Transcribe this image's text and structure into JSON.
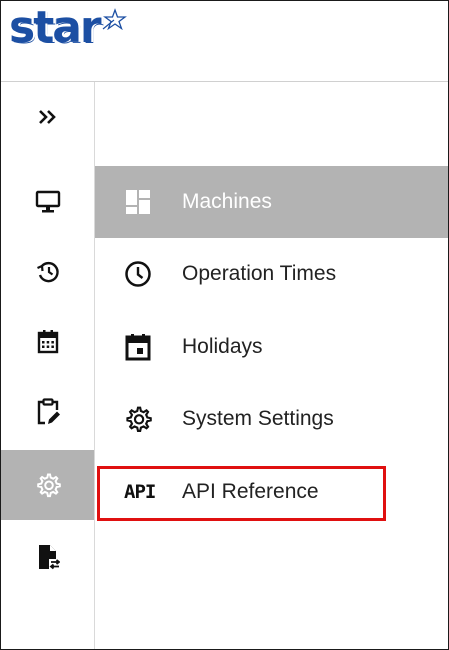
{
  "brand": {
    "logo_text": "star"
  },
  "rail": {
    "expand": {
      "icon": "double-chevron-right-icon",
      "glyph": "»"
    },
    "items": [
      {
        "key": "monitor",
        "icon": "monitor-icon"
      },
      {
        "key": "history",
        "icon": "history-icon"
      },
      {
        "key": "calendar",
        "icon": "calendar-icon"
      },
      {
        "key": "clipboard",
        "icon": "clipboard-edit-icon"
      },
      {
        "key": "settings",
        "icon": "gear-icon",
        "active": true
      },
      {
        "key": "file-transfer",
        "icon": "file-transfer-icon"
      }
    ]
  },
  "menu": {
    "items": [
      {
        "key": "machines",
        "label": "Machines",
        "icon": "dashboard-icon",
        "active": true
      },
      {
        "key": "operation-times",
        "label": "Operation Times",
        "icon": "clock-icon"
      },
      {
        "key": "holidays",
        "label": "Holidays",
        "icon": "calendar-event-icon"
      },
      {
        "key": "system-settings",
        "label": "System Settings",
        "icon": "gear-icon"
      },
      {
        "key": "api-reference",
        "label": "API Reference",
        "icon": "api-icon",
        "icon_text": "API",
        "highlighted": true
      }
    ]
  },
  "colors": {
    "brand_blue": "#1c4fa3",
    "active_bg": "#b3b3b3",
    "highlight_border": "#e01010"
  }
}
